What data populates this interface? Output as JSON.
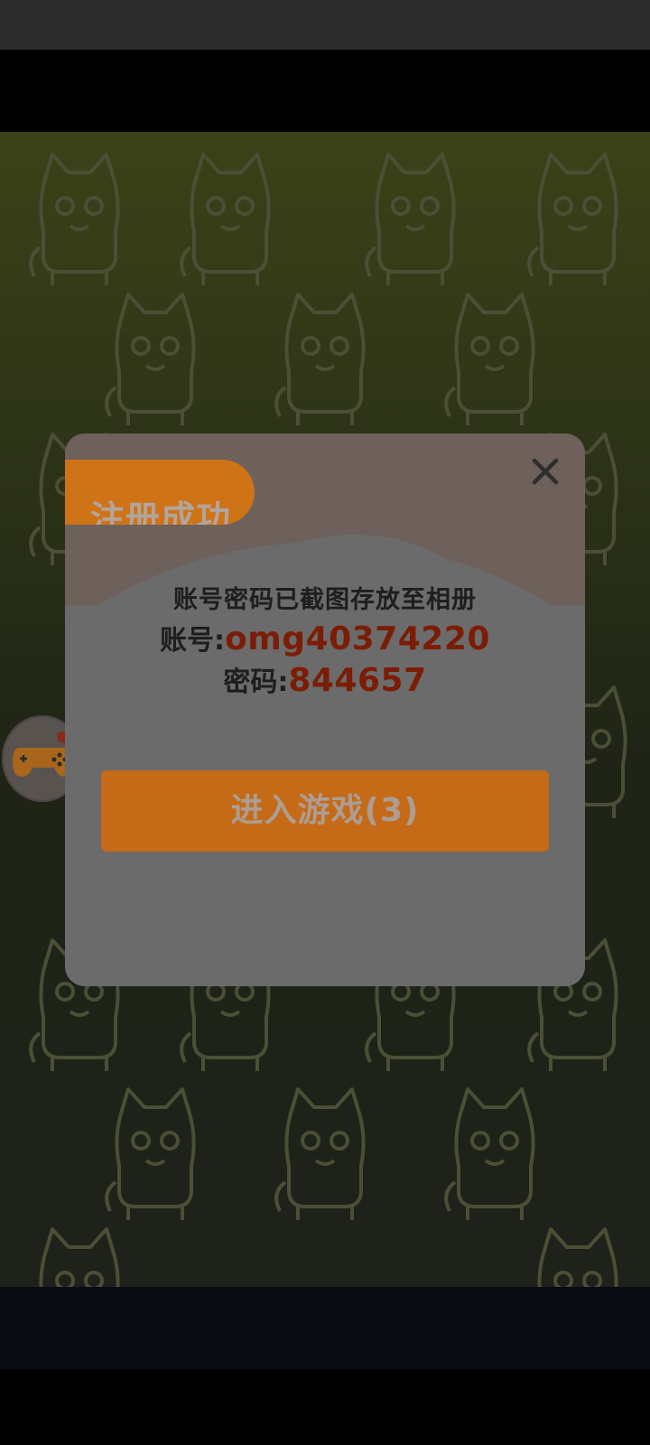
{
  "dialog": {
    "title": "注册成功",
    "message": "账号密码已截图存放至相册",
    "account_label": "账号:",
    "account_value": "omg40374220",
    "password_label": "密码:",
    "password_value": "844657",
    "enter_button_label": "进入游戏(3)",
    "close_icon": "close-icon"
  },
  "floating_button": {
    "icon": "gamepad-icon"
  },
  "colors": {
    "accent_orange": "#ce7417",
    "value_red": "#7b1d06",
    "background_green": "#2b3119"
  }
}
